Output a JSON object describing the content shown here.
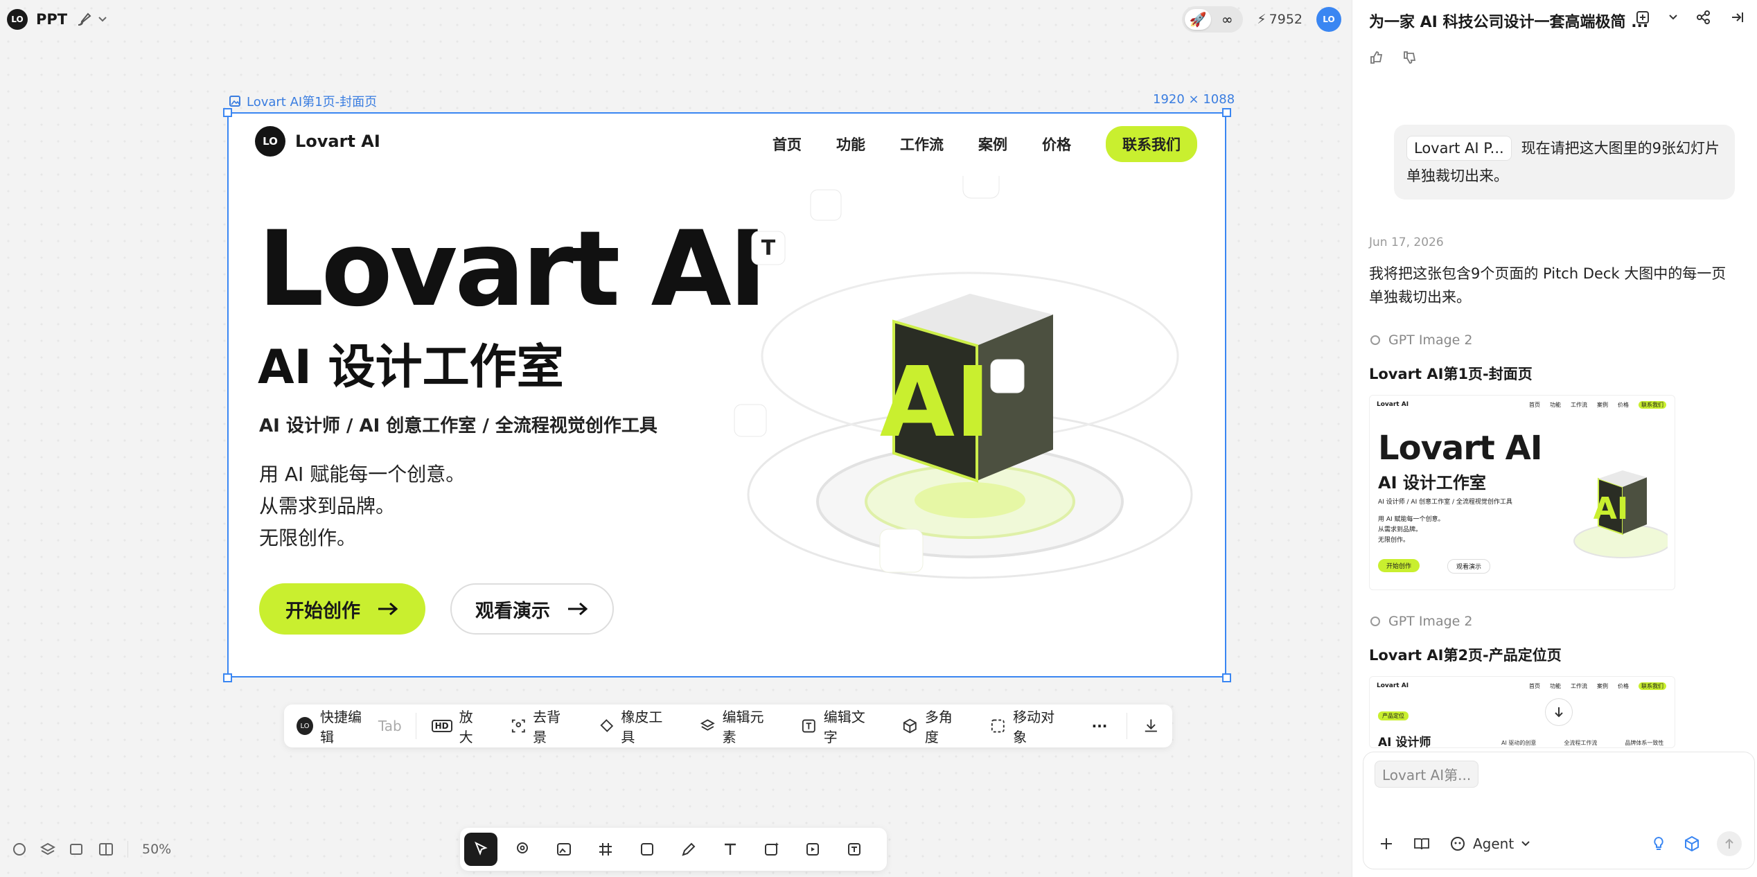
{
  "app": {
    "project_name": "PPT",
    "credits": "7952",
    "infinity": "∞",
    "avatar_text": "LO"
  },
  "frame": {
    "label": "Lovart AI第1页-封面页",
    "size": "1920 × 1088"
  },
  "slide": {
    "logo_mark": "LO",
    "logo_text": "Lovart AI",
    "nav": [
      "首页",
      "功能",
      "工作流",
      "案例",
      "价格"
    ],
    "nav_cta": "联系我们",
    "headline": "Lovart AI",
    "subheadline": "AI 设计工作室",
    "tagline": "AI 设计师 / AI 创意工作室 / 全流程视觉创作工具",
    "body_lines": [
      "用 AI 赋能每一个创意。",
      "从需求到品牌。",
      "无限创作。"
    ],
    "primary_button": "开始创作",
    "secondary_button": "观看演示",
    "cube_text": "AI"
  },
  "edit_toolbar": {
    "quick_edit": "快捷编辑",
    "quick_edit_hint": "Tab",
    "items": [
      "放大",
      "去背景",
      "橡皮工具",
      "编辑元素",
      "编辑文字",
      "多角度",
      "移动对象"
    ],
    "more": "···"
  },
  "zoom": "50%",
  "panel": {
    "title": "为一家 AI 科技公司设计一套高端极简 ...",
    "user_chip": "Lovart AI P...",
    "user_message": "现在请把这大图里的9张幻灯片单独裁切出来。",
    "date": "Jun 17, 2026",
    "assistant_message": "我将把这张包含9个页面的 Pitch Deck 大图中的每一页单独裁切出来。",
    "generations": [
      {
        "model": "GPT Image 2",
        "title": "Lovart AI第1页-封面页"
      },
      {
        "model": "GPT Image 2",
        "title": "Lovart AI第2页-产品定位页"
      }
    ],
    "thumb1": {
      "headline": "Lovart AI",
      "sub": "AI 设计工作室",
      "tag": "AI 设计师 / AI 创意工作室 / 全流程视觉创作工具",
      "lines": [
        "用 AI 赋能每一个创意。",
        "从需求到品牌。",
        "无限创作。"
      ],
      "b1": "开始创作",
      "b2": "观看演示",
      "nav": [
        "首页",
        "功能",
        "工作流",
        "案例",
        "价格"
      ],
      "cta": "联系我们",
      "logo": "Lovart AI"
    },
    "thumb2": {
      "badge": "产品定位",
      "title": "AI 设计师",
      "logo": "Lovart AI",
      "nav": [
        "首页",
        "功能",
        "工作流",
        "案例",
        "价格"
      ],
      "cta": "联系我们",
      "cols": [
        "AI 驱动的创意",
        "全流程工作流",
        "品牌体系一致性"
      ]
    },
    "composer_chip": "Lovart AI第...",
    "agent_label": "Agent"
  }
}
